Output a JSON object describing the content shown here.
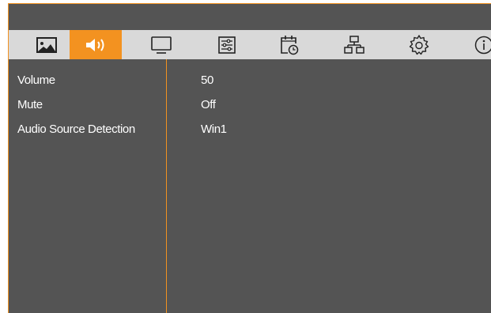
{
  "colors": {
    "accent": "#f39220",
    "panel": "#545454",
    "tabbar": "#d9d9d9"
  },
  "tabs": [
    {
      "icon": "picture-icon",
      "active": false
    },
    {
      "icon": "speaker-icon",
      "active": true
    },
    {
      "icon": "monitor-icon",
      "active": false
    },
    {
      "icon": "settings-sliders-icon",
      "active": false
    },
    {
      "icon": "schedule-clock-icon",
      "active": false
    },
    {
      "icon": "network-icon",
      "active": false
    },
    {
      "icon": "gear-icon",
      "active": false
    },
    {
      "icon": "info-icon",
      "active": false
    }
  ],
  "menu": [
    {
      "label": "Volume",
      "value": "50"
    },
    {
      "label": "Mute",
      "value": "Off"
    },
    {
      "label": "Audio Source Detection",
      "value": "Win1"
    }
  ]
}
